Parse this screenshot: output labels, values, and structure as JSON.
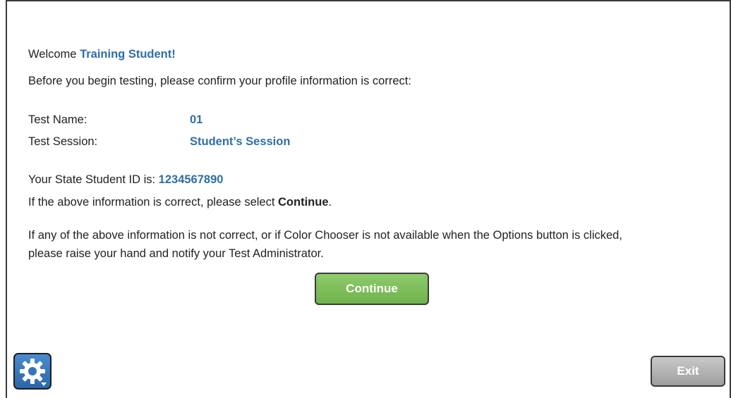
{
  "welcome": {
    "prefix": "Welcome ",
    "name": "Training Student!"
  },
  "intro": "Before you begin testing, please confirm your profile information is correct:",
  "fields": [
    {
      "label": "Test Name:",
      "value": "01"
    },
    {
      "label": "Test Session:",
      "value": "Student’s Session"
    }
  ],
  "student_id": {
    "prefix": "Your State Student ID is: ",
    "value": "1234567890"
  },
  "confirm": {
    "prefix": "If the above information is correct, please select ",
    "emphasis": "Continue",
    "suffix": "."
  },
  "help_text": {
    "line1": "If any of the above information is not correct, or if Color Chooser is not available when the Options button is clicked,",
    "line2": "please raise your hand and notify your Test Administrator."
  },
  "buttons": {
    "continue": "Continue",
    "exit": "Exit",
    "options_icon": "gear-icon"
  },
  "colors": {
    "accent": "#2f6ea8",
    "continue_bg": "#7dbf58",
    "options_bg": "#3a7bbf",
    "exit_bg": "#b3b3b3"
  }
}
